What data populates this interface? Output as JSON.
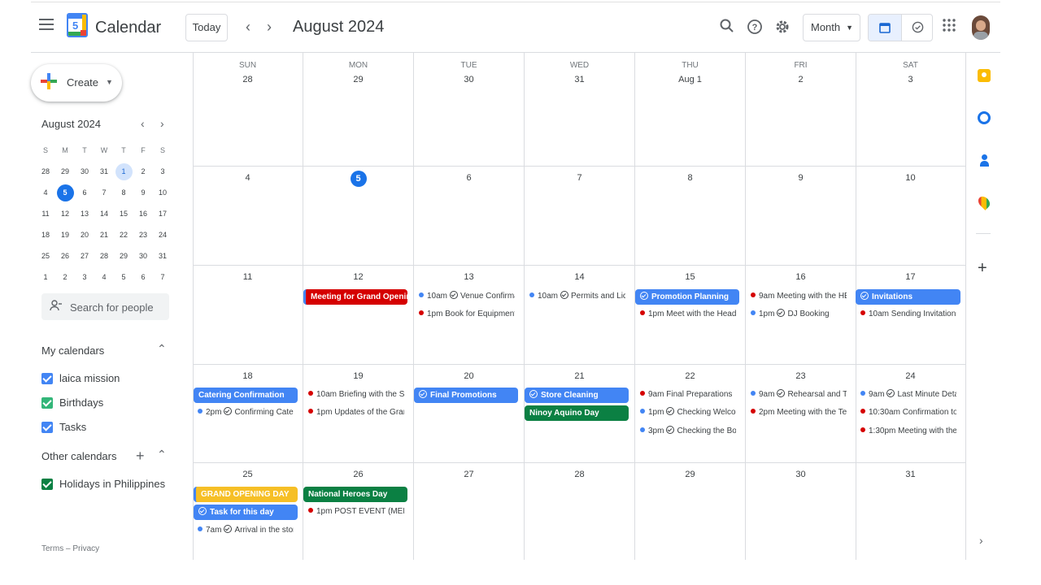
{
  "colors": {
    "blue": "#4285f4",
    "event_blue": "#4285f4",
    "red": "#d50000",
    "green": "#0b8043",
    "yellow": "#f6bf26",
    "dot_blue": "#4285f4",
    "dot_red": "#d50000",
    "today": "#1a73e8"
  },
  "header": {
    "menu_icon": "hamburger-menu-icon",
    "logo_day": "5",
    "app_name": "Calendar",
    "today_label": "Today",
    "prev_icon": "chevron-left-icon",
    "next_icon": "chevron-right-icon",
    "period": "August 2024",
    "search_icon": "search-icon",
    "help_icon": "help-icon",
    "settings_icon": "gear-icon",
    "view": "Month",
    "calendar_view_icon": "calendar-icon",
    "tasks_view_icon": "check-circle-icon",
    "apps_icon": "apps-grid-icon",
    "avatar_icon": "user-avatar"
  },
  "sidebar": {
    "create_label": "Create",
    "mini_title": "August 2024",
    "weekday_headers": [
      "S",
      "M",
      "T",
      "W",
      "T",
      "F",
      "S"
    ],
    "mini_weeks": [
      [
        "28",
        "29",
        "30",
        "31",
        "1",
        "2",
        "3"
      ],
      [
        "4",
        "5",
        "6",
        "7",
        "8",
        "9",
        "10"
      ],
      [
        "11",
        "12",
        "13",
        "14",
        "15",
        "16",
        "17"
      ],
      [
        "18",
        "19",
        "20",
        "21",
        "22",
        "23",
        "24"
      ],
      [
        "25",
        "26",
        "27",
        "28",
        "29",
        "30",
        "31"
      ],
      [
        "1",
        "2",
        "3",
        "4",
        "5",
        "6",
        "7"
      ]
    ],
    "search_people": "Search for people",
    "my_calendars_title": "My calendars",
    "my_calendars": [
      {
        "label": "laica mission",
        "color": "#4285f4"
      },
      {
        "label": "Birthdays",
        "color": "#33b679"
      },
      {
        "label": "Tasks",
        "color": "#4285f4"
      }
    ],
    "other_calendars_title": "Other calendars",
    "other_calendars": [
      {
        "label": "Holidays in Philippines",
        "color": "#0b8043"
      }
    ],
    "footer_terms": "Terms",
    "footer_sep": "–",
    "footer_privacy": "Privacy"
  },
  "month": {
    "weekdays": [
      "SUN",
      "MON",
      "TUE",
      "WED",
      "THU",
      "FRI",
      "SAT"
    ],
    "weeks": [
      [
        "28",
        "29",
        "30",
        "31",
        "Aug 1",
        "2",
        "3"
      ],
      [
        "4",
        "5",
        "6",
        "7",
        "8",
        "9",
        "10"
      ],
      [
        "11",
        "12",
        "13",
        "14",
        "15",
        "16",
        "17"
      ],
      [
        "18",
        "19",
        "20",
        "21",
        "22",
        "23",
        "24"
      ],
      [
        "25",
        "26",
        "27",
        "28",
        "29",
        "30",
        "31"
      ]
    ],
    "today": "5"
  },
  "events": {
    "w3_mon_chip": "Meeting for Grand Opening",
    "w3_tue_1_time": "10am",
    "w3_tue_1_title": "Venue Confirmat",
    "w3_tue_2_time": "1pm",
    "w3_tue_2_title": "Book for Equipment",
    "w3_wed_1_time": "10am",
    "w3_wed_1_title": "Permits and Lice",
    "w3_thu_chip": "Promotion Planning",
    "w3_thu_2_time": "1pm",
    "w3_thu_2_title": "Meet with the Head o",
    "w3_fri_1_time": "9am",
    "w3_fri_1_title": "Meeting with the HEA",
    "w3_fri_2_time": "1pm",
    "w3_fri_2_title": "DJ Booking",
    "w3_sat_chip": "Invitations",
    "w3_sat_2_time": "10am",
    "w3_sat_2_title": "Sending Invitations",
    "w4_sun_chip": "Catering Confirmation",
    "w4_sun_2_time": "2pm",
    "w4_sun_2_title": "Confirming Cateri",
    "w4_mon_1_time": "10am",
    "w4_mon_1_title": "Briefing with the Sta",
    "w4_mon_2_time": "1pm",
    "w4_mon_2_title": "Updates of the Grand",
    "w4_tue_chip": "Final Promotions",
    "w4_wed_chip": "Store Cleaning",
    "w4_wed_holiday": "Ninoy Aquino Day",
    "w4_thu_1_time": "9am",
    "w4_thu_1_title": "Final Preparations",
    "w4_thu_2_time": "1pm",
    "w4_thu_2_title": "Checking Welcom",
    "w4_thu_3_time": "3pm",
    "w4_thu_3_title": "Checking the Boot",
    "w4_fri_1_time": "9am",
    "w4_fri_1_title": "Rehearsal and Tec",
    "w4_fri_2_time": "2pm",
    "w4_fri_2_title": "Meeting with the Tear",
    "w4_sat_1_time": "9am",
    "w4_sat_1_title": "Last Minute Detail",
    "w4_sat_2_time": "10:30am",
    "w4_sat_2_title": "Confirmation to S",
    "w4_sat_3_time": "1:30pm",
    "w4_sat_3_title": "Meeting with the t",
    "w5_sun_chip1": "GRAND OPENING DAY",
    "w5_sun_chip2": "Task for this day",
    "w5_sun_3_time": "7am",
    "w5_sun_3_title": "Arrival in the store",
    "w5_mon_holiday": "National Heroes Day",
    "w5_mon_2_time": "1pm",
    "w5_mon_2_title": "POST EVENT (MEETII"
  },
  "rail": {
    "keep_icon": "keep-icon",
    "tasks_icon": "tasks-icon",
    "contacts_icon": "contacts-icon",
    "maps_icon": "maps-icon",
    "add_icon": "plus-icon",
    "expand_icon": "chevron-right-icon"
  }
}
